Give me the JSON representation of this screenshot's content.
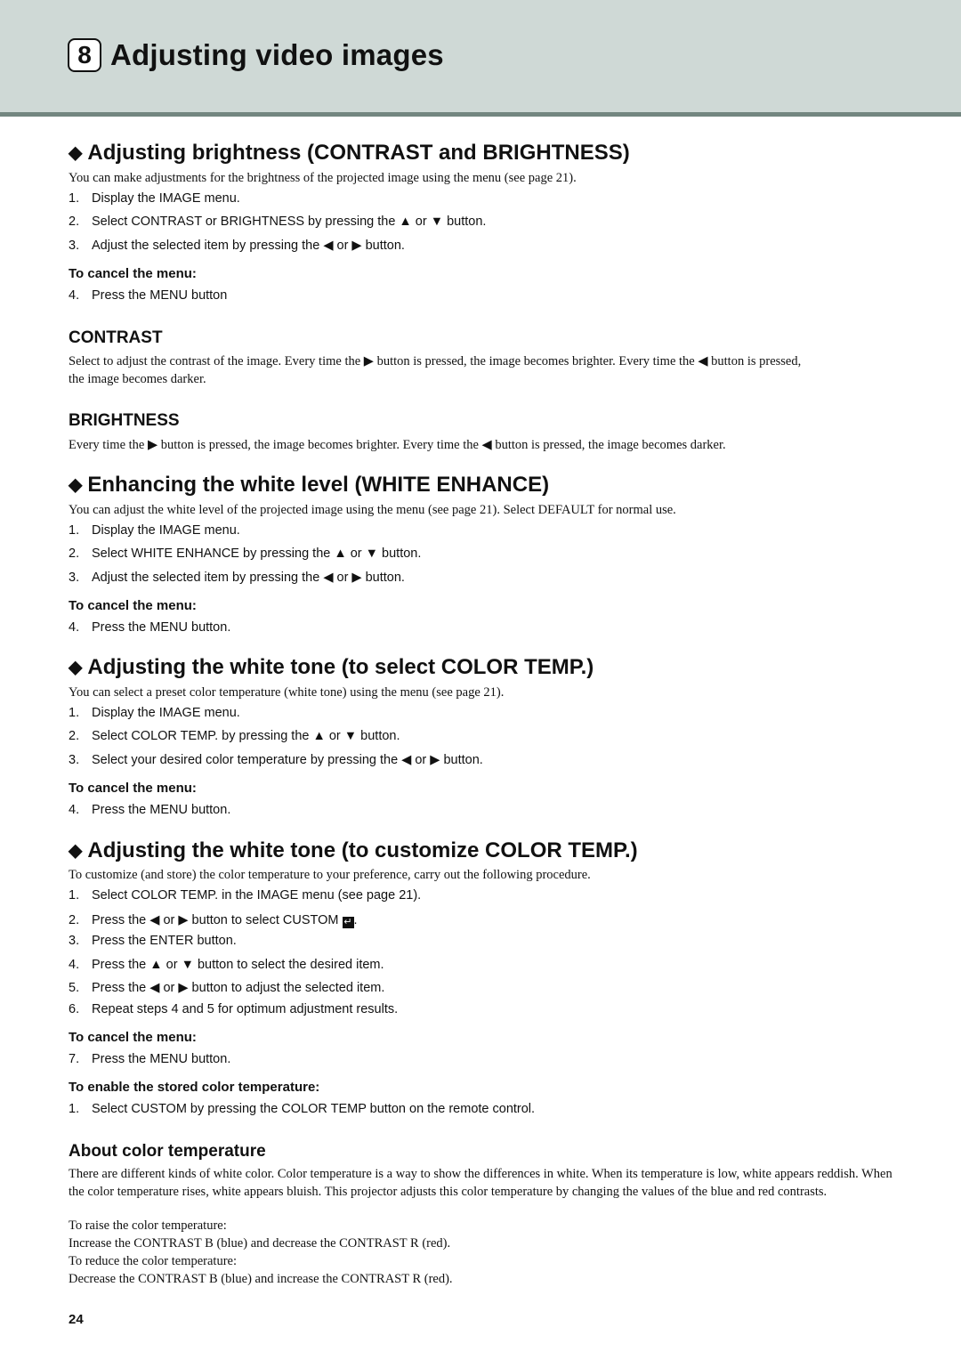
{
  "header": {
    "chapter_number": "8",
    "chapter_title": "Adjusting video images"
  },
  "sections": {
    "brightness": {
      "title": "Adjusting brightness (CONTRAST and BRIGHTNESS)",
      "intro": "You can make adjustments for the brightness of the projected image using the menu (see page 21).",
      "steps": [
        {
          "n": "1.",
          "text": "Display the IMAGE menu."
        },
        {
          "n": "2.",
          "text": "Select CONTRAST or BRIGHTNESS by pressing the ▲ or ▼ button."
        },
        {
          "n": "3.",
          "text": "Adjust the selected item by pressing the ◀ or ▶ button."
        }
      ],
      "cancel_label": "To cancel the menu:",
      "cancel_step": {
        "n": "4.",
        "text": "Press the MENU button"
      },
      "contrast": {
        "title": "CONTRAST",
        "line1": "Select to adjust the contrast of the image. Every time the ▶ button is pressed, the image becomes brighter. Every time the ◀ button is pressed,",
        "line2": "the image becomes darker."
      },
      "brightness_item": {
        "title": "BRIGHTNESS",
        "text": "Every time the ▶ button is pressed, the image becomes brighter. Every time the ◀ button is pressed, the image becomes darker."
      }
    },
    "white_enhance": {
      "title": "Enhancing the white level (WHITE ENHANCE)",
      "intro": "You can adjust the white level of the projected image using the menu (see page 21). Select DEFAULT for normal use.",
      "steps": [
        {
          "n": "1.",
          "text": "Display the IMAGE menu."
        },
        {
          "n": "2.",
          "text": "Select WHITE ENHANCE by pressing the ▲ or ▼ button."
        },
        {
          "n": "3.",
          "text": "Adjust the selected item by pressing the ◀ or ▶ button."
        }
      ],
      "cancel_label": "To cancel the menu:",
      "cancel_step": {
        "n": "4.",
        "text": "Press the MENU button."
      }
    },
    "select_color_temp": {
      "title": "Adjusting the white tone (to select COLOR TEMP.)",
      "intro": "You can select a preset color temperature (white tone) using the menu (see page 21).",
      "steps": [
        {
          "n": "1.",
          "text": "Display the IMAGE menu."
        },
        {
          "n": "2.",
          "text": "Select COLOR TEMP. by pressing the ▲ or ▼ button."
        },
        {
          "n": "3.",
          "text": "Select your desired color temperature by pressing the ◀ or ▶ button."
        }
      ],
      "cancel_label": "To cancel the menu:",
      "cancel_step": {
        "n": "4.",
        "text": "Press the MENU button."
      }
    },
    "customize_color_temp": {
      "title": "Adjusting the white tone (to customize COLOR TEMP.)",
      "intro": "To customize (and store) the color temperature to your preference, carry out the following procedure.",
      "steps": [
        {
          "n": "1.",
          "text": "Select COLOR TEMP. in the IMAGE menu (see page 21)."
        },
        {
          "n": "2.",
          "text": "Press the ◀ or ▶ button to select CUSTOM",
          "suffix": "."
        },
        {
          "n": "3.",
          "text": "Press the ENTER button."
        },
        {
          "n": "4.",
          "text": "Press the ▲ or ▼ button to select the desired item."
        },
        {
          "n": "5.",
          "text": "Press the ◀ or ▶ button to adjust the selected item."
        },
        {
          "n": "6.",
          "text": "Repeat steps 4 and 5 for optimum adjustment results."
        }
      ],
      "cancel_label": "To cancel the menu:",
      "cancel_step": {
        "n": "7.",
        "text": "Press the MENU button."
      },
      "enable_label": "To enable the stored color temperature:",
      "enable_step": {
        "n": "1.",
        "text": "Select CUSTOM by pressing the COLOR TEMP button on the remote control."
      }
    },
    "about": {
      "title": "About color temperature",
      "paragraph": "There are different kinds of white color. Color temperature is a way to show the differences in white. When its temperature is low, white appears reddish. When the color temperature rises, white appears bluish. This projector adjusts this color temperature by changing the values of the blue and red contrasts.",
      "lines": [
        "To raise the color temperature:",
        "Increase the CONTRAST B (blue) and decrease the CONTRAST R (red).",
        "To reduce the color temperature:",
        "Decrease the CONTRAST B (blue) and increase the CONTRAST R (red)."
      ]
    }
  },
  "footer": {
    "page_number": "24"
  },
  "colors": {
    "header_bg": "#cfd9d6",
    "header_rule": "#738680"
  }
}
